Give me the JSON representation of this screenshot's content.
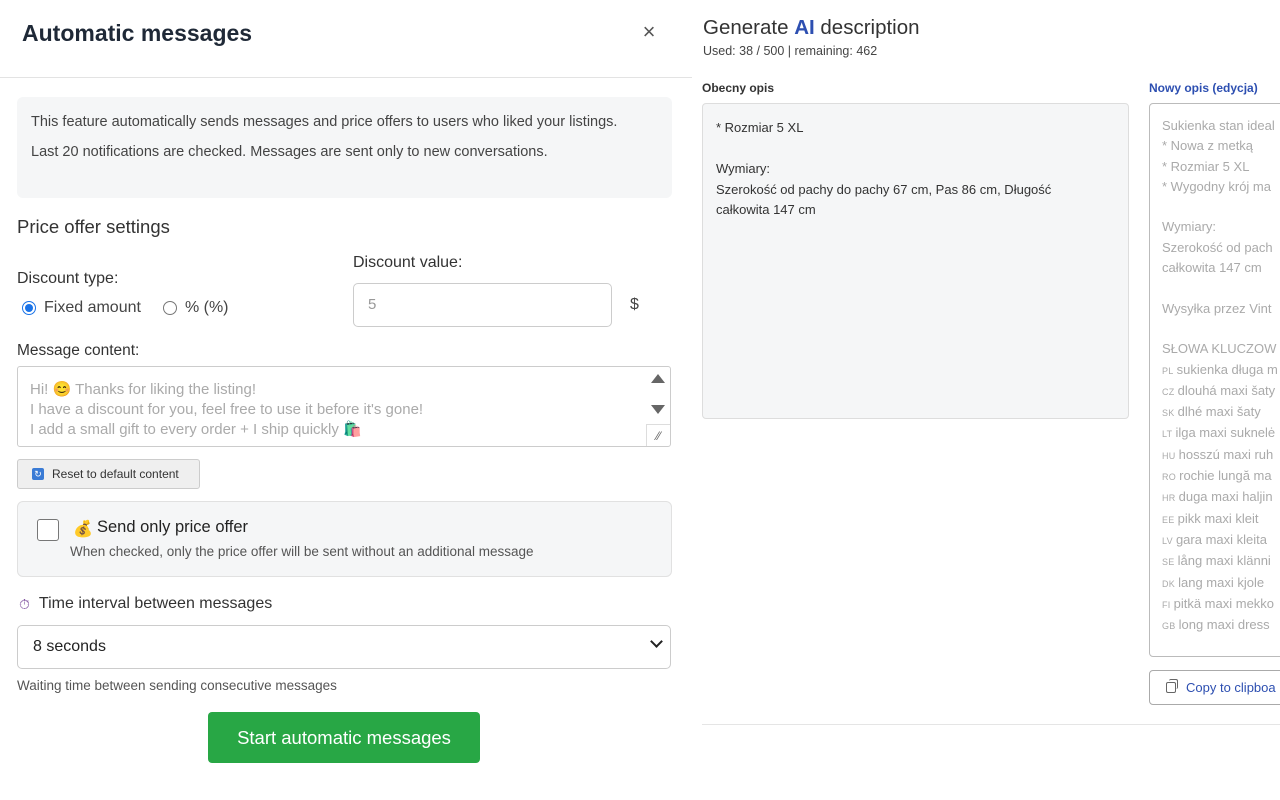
{
  "auto_messages": {
    "title": "Automatic messages",
    "close_symbol": "×",
    "info_line1": "This feature automatically sends messages and price offers to users who liked your listings.",
    "info_line2": "Last 20 notifications are checked. Messages are sent only to new conversations.",
    "price_offer_title": "Price offer settings",
    "discount_type_label": "Discount type:",
    "discount_type_options": [
      "Fixed amount",
      "% (%)"
    ],
    "discount_type_selected": "Fixed amount",
    "discount_value_label": "Discount value:",
    "discount_value_placeholder": "5",
    "currency": "$",
    "message_content_label": "Message content:",
    "message_lines": [
      "Hi! 😊 Thanks for liking the listing!",
      "I have a discount for you, feel free to use it before it's gone!",
      "I add a small gift to every order + I ship quickly 🛍️"
    ],
    "reset_button": "Reset to default content",
    "send_only_offer_icon": "💰",
    "send_only_offer_label": "Send only price offer",
    "send_only_offer_desc": "When checked, only the price offer will be sent without an additional message",
    "send_only_offer_checked": false,
    "time_interval_icon": "⏱",
    "time_interval_label": "Time interval between messages",
    "time_interval_value": "8 seconds",
    "time_interval_helper": "Waiting time between sending consecutive messages",
    "start_button": "Start automatic messages"
  },
  "ai_description": {
    "title_prefix": "Generate",
    "title_ai": "AI",
    "title_suffix": "description",
    "usage": "Used: 38 / 500 | remaining: 462",
    "current_label": "Obecny opis",
    "current_lines": [
      "* Rozmiar 5 XL",
      "",
      "Wymiary:",
      "Szerokość od pachy do pachy 67 cm, Pas 86 cm, Długość",
      "całkowita 147 cm"
    ],
    "new_label": "Nowy opis (edycja)",
    "new_lines": [
      "Sukienka stan ideal",
      "* Nowa z metką",
      "* Rozmiar 5 XL",
      "* Wygodny krój ma",
      "",
      "Wymiary:",
      "Szerokość od pach",
      "całkowita 147 cm",
      "",
      "Wysyłka przez Vint",
      "",
      "SŁOWA KLUCZOW"
    ],
    "keywords": [
      {
        "code": "PL",
        "text": "sukienka długa m"
      },
      {
        "code": "CZ",
        "text": "dlouhá maxi šaty"
      },
      {
        "code": "SK",
        "text": "dlhé maxi šaty"
      },
      {
        "code": "LT",
        "text": "ilga maxi suknelė"
      },
      {
        "code": "HU",
        "text": "hosszú maxi ruh"
      },
      {
        "code": "RO",
        "text": "rochie lungă ma"
      },
      {
        "code": "HR",
        "text": "duga maxi haljin"
      },
      {
        "code": "EE",
        "text": "pikk maxi kleit"
      },
      {
        "code": "LV",
        "text": "gara maxi kleita"
      },
      {
        "code": "SE",
        "text": "lång maxi klänni"
      },
      {
        "code": "DK",
        "text": "lang maxi kjole"
      },
      {
        "code": "FI",
        "text": "pitkä maxi mekko"
      },
      {
        "code": "GB",
        "text": "long maxi dress"
      }
    ],
    "copy_button": "Copy to clipboa"
  },
  "colors": {
    "start_button": "#28a745",
    "accent_blue": "#2d4fb1",
    "radio_selected": "#1a73e8"
  }
}
